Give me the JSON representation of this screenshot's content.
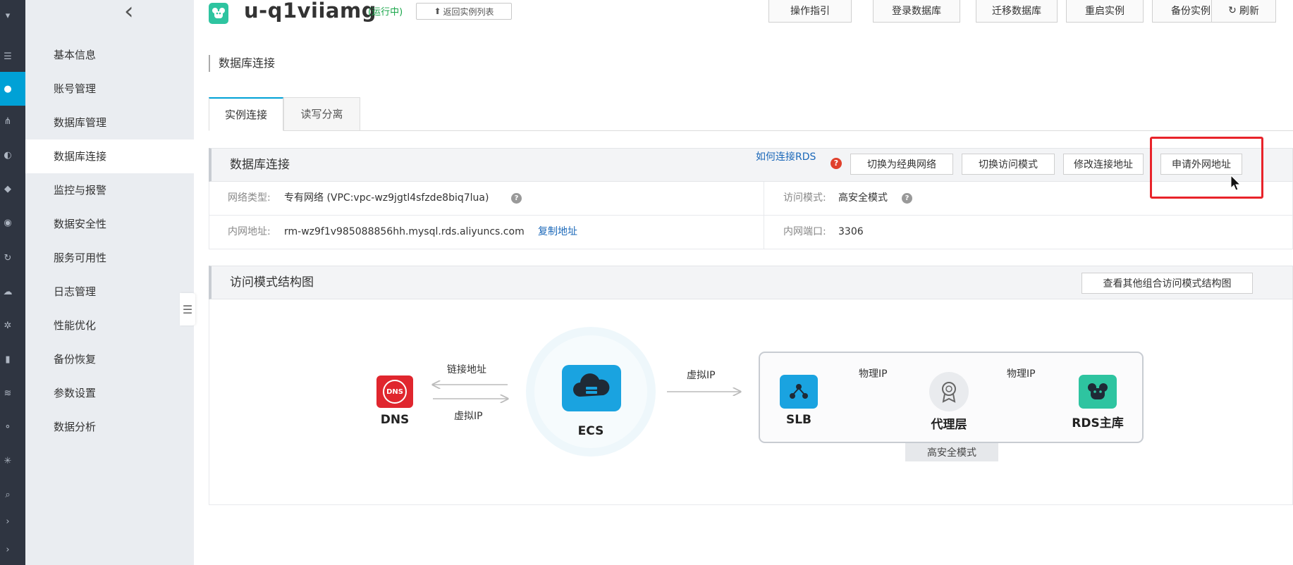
{
  "header": {
    "instance_name": "u-q1viiamg",
    "status": "(运行中)",
    "back_to_list": "返回实例列表",
    "buttons": [
      "操作指引",
      "登录数据库",
      "迁移数据库",
      "重启实例",
      "备份实例",
      "刷新"
    ]
  },
  "sidebar": {
    "items": [
      {
        "label": "基本信息"
      },
      {
        "label": "账号管理"
      },
      {
        "label": "数据库管理"
      },
      {
        "label": "数据库连接"
      },
      {
        "label": "监控与报警"
      },
      {
        "label": "数据安全性"
      },
      {
        "label": "服务可用性"
      },
      {
        "label": "日志管理"
      },
      {
        "label": "性能优化"
      },
      {
        "label": "备份恢复"
      },
      {
        "label": "参数设置"
      },
      {
        "label": "数据分析"
      }
    ],
    "active_index": 3
  },
  "page": {
    "section_title": "数据库连接",
    "tabs": [
      {
        "label": "实例连接"
      },
      {
        "label": "读写分离"
      }
    ]
  },
  "connection_panel": {
    "title": "数据库连接",
    "help_link": "如何连接RDS",
    "buttons": [
      "切换为经典网络",
      "切换访问模式",
      "修改连接地址",
      "申请外网地址"
    ],
    "rows": [
      {
        "label1": "网络类型:",
        "value1": "专有网络 (VPC:vpc-wz9jgtl4sfzde8biq7lua)",
        "label2": "访问模式:",
        "value2": "高安全模式"
      },
      {
        "label1": "内网地址:",
        "value1": "rm-wz9f1v985088856hh.mysql.rds.aliyuncs.com",
        "copy": "复制地址",
        "label2": "内网端口:",
        "value2": "3306"
      }
    ]
  },
  "diagram_panel": {
    "title": "访问模式结构图",
    "button": "查看其他组合访问模式结构图",
    "nodes": {
      "dns": "DNS",
      "ecs": "ECS",
      "slb": "SLB",
      "proxy": "代理层",
      "rds": "RDS主库"
    },
    "edges": {
      "link_addr": "链接地址",
      "virtual_ip_left": "虚拟IP",
      "virtual_ip_mid": "虚拟IP",
      "phys_ip_1": "物理IP",
      "phys_ip_2": "物理IP"
    },
    "mode_tag": "高安全模式",
    "dns_badge": "DNS"
  },
  "colors": {
    "accent": "#00a1d6",
    "link": "#1b68b9",
    "highlight": "#e8232a",
    "rds_green": "#2ec4a0"
  },
  "icons": [
    "chevron-left-icon",
    "logo-icon",
    "refresh-icon",
    "help-icon",
    "cursor-icon",
    "dns-icon",
    "ecs-cloud-icon",
    "slb-icon",
    "proxy-badge-icon",
    "rds-icon"
  ]
}
